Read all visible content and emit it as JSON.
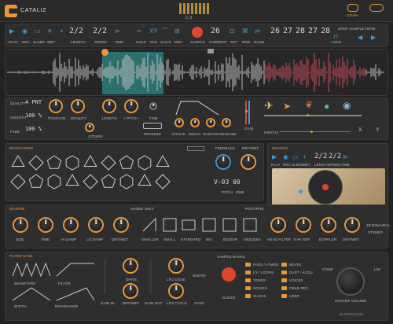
{
  "header": {
    "logo": "CATALIZ",
    "note": "C 3",
    "grain": "GRAIN",
    "drop": "DROP SAMPLE HERE",
    "lock": "LOCK"
  },
  "transport": {
    "play": "PLAY",
    "rec": "REC",
    "sleek": "SLEEK",
    "wet": "WET",
    "length_val": "2/2",
    "length": "LENGTH",
    "speed_val": "2/2",
    "speed": "SPEED",
    "time": "TIME",
    "hold": "HOLD",
    "pad": "PAD",
    "click": "CLICK",
    "midi": "MIDI",
    "sample": "SAMPLE",
    "current_val": "26",
    "current": "CURRENT",
    "set": "SET",
    "rnd": "RND",
    "rand": "RAND",
    "seq": [
      "26",
      "27",
      "28",
      "27",
      "28"
    ]
  },
  "grain": {
    "quality": "QUALITY",
    "quality_val": "4 PNT",
    "smooth": "SMOOTH",
    "smooth_val": "100 %",
    "fade": "FADE",
    "fade_val": "100 %",
    "position": "POSITION",
    "density": "DENSITY",
    "jitters": "JITTERS",
    "length": "LENGTH",
    "pitch": "+ PITCH -",
    "fine": "FINE",
    "reverse": "REVERSE",
    "attack": "ATTACK",
    "decay": "DECAY",
    "sustain": "SUSTAIN",
    "release": "RELEASE",
    "gain": "GAIN",
    "inertia": "INERTIA",
    "x": "X",
    "y": "Y"
  },
  "resochord": {
    "title": "RESOCHORD",
    "feedback": "FEEDBACK",
    "drywet": "DRY/WET",
    "pitch": "PITCH",
    "fine": "FINE",
    "display": "V-03  00"
  },
  "imaging": {
    "title": "IMAGING",
    "play": "PLAY",
    "rec": "REC",
    "sleek": "SLEEK",
    "wet": "WET",
    "length_val": "2/2",
    "length": "LENGTH",
    "speed_val": "2/2",
    "speed": "SPEED",
    "time": "TIME"
  },
  "reverb": {
    "title": "REVERB",
    "knobs_only": "KNOBS ONLY",
    "post_pre": "POST/PRE",
    "knobs": [
      "SIZE",
      "TIME",
      "HI DAMP",
      "LO DAMP",
      "DRY/WET"
    ],
    "rooms": [
      "SMALLER",
      "SMALL",
      "STANDARD",
      "BIG",
      "BIGGER",
      "ENDLESS"
    ],
    "right": [
      "HEAD FILTER",
      "EAR SEP.",
      "DOPPLER",
      "DRY/WET"
    ],
    "binaural": "3D BINAURAL",
    "stereo": "STEREO"
  },
  "filter": {
    "title": "FILTER BANK",
    "waveform": "WAVEFORM",
    "filter": "FILTER",
    "width": "WIDTH",
    "resonance": "RESONANCE",
    "drive": "DRIVE",
    "lfo_dose": "LFO DOSE",
    "sin_tri": "SIN/TRI",
    "gain_in": "GAIN IN",
    "drywet": "DRY/WET",
    "gain_out": "GAIN OUT",
    "lfo_cycle": "LFO CYCLE",
    "sync": "SYNC",
    "sample_banks": "SAMPLE BANKS",
    "slices": "SLICES",
    "banks_left": [
      "PADS / ATMOS",
      "FX / LOOPS",
      "TONES",
      "NOISES",
      "SLICES"
    ],
    "banks_right": [
      "BEATS",
      "DUST / ACOU",
      "VOICES",
      "FIELD REC",
      "USER"
    ],
    "comp": "COMP",
    "lim": "LIM",
    "master": "MASTER VOLUME",
    "brand": "BLINDSOUND"
  },
  "colors": {
    "accent": "#e8973a",
    "blue": "#3a9ad9",
    "red": "#e0452e",
    "bg": "#2e2e2e"
  }
}
